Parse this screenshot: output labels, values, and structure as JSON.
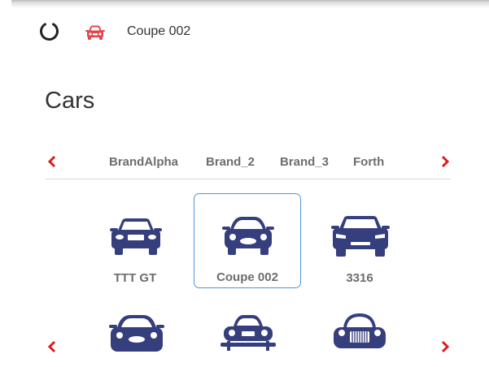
{
  "topbar": {
    "title": "Coupe 002",
    "spinner_icon": "spinner-icon",
    "car_icon": "car-icon",
    "car_icon_color": "#e0464a"
  },
  "page": {
    "title": "Cars"
  },
  "brand_tabs": {
    "prev_icon": "chevron-left-icon",
    "next_icon": "chevron-right-icon",
    "items": [
      {
        "label": "BrandAlpha"
      },
      {
        "label": "Brand_2"
      },
      {
        "label": "Brand_3"
      },
      {
        "label": "Forth"
      }
    ]
  },
  "car_grid": {
    "items": [
      {
        "label": "TTT GT",
        "icon": "sedan-car-icon",
        "selected": false
      },
      {
        "label": "Coupe 002",
        "icon": "coupe-car-icon",
        "selected": true
      },
      {
        "label": "3316",
        "icon": "suv-car-icon",
        "selected": false
      }
    ],
    "next_row_icons": [
      "sports-car-icon",
      "classic-car-icon",
      "vintage-car-icon"
    ],
    "prev_icon": "chevron-left-icon",
    "next_icon": "chevron-right-icon"
  },
  "colors": {
    "accent_red": "#e01b1b",
    "car_navy": "#363f7d",
    "selected_border": "#4f95d6",
    "label_gray": "#6d6d6d"
  }
}
